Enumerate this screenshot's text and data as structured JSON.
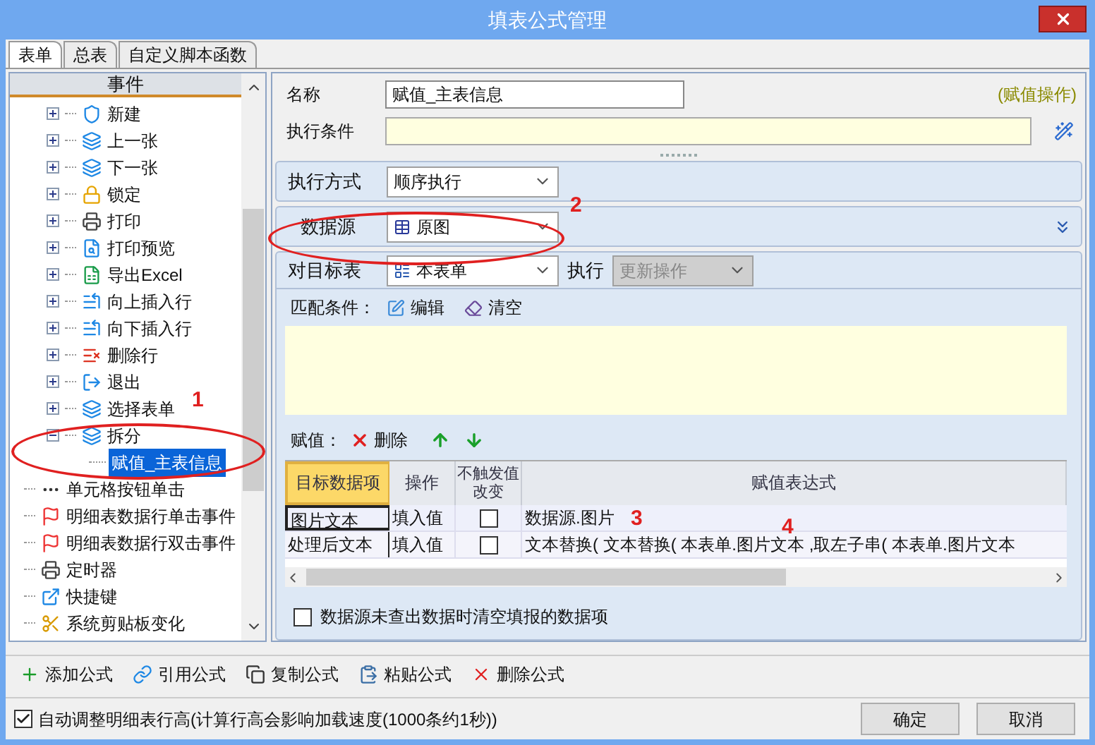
{
  "window": {
    "title": "填表公式管理"
  },
  "tabs": [
    {
      "label": "表单",
      "selected": true
    },
    {
      "label": "总表",
      "selected": false
    },
    {
      "label": "自定义脚本函数",
      "selected": false
    }
  ],
  "sidebar": {
    "header": "事件",
    "items": [
      {
        "label": "新建",
        "kind": "group",
        "expanded": false
      },
      {
        "label": "上一张",
        "kind": "group",
        "expanded": false
      },
      {
        "label": "下一张",
        "kind": "group",
        "expanded": false
      },
      {
        "label": "锁定",
        "kind": "group",
        "expanded": false
      },
      {
        "label": "打印",
        "kind": "group",
        "expanded": false
      },
      {
        "label": "打印预览",
        "kind": "group",
        "expanded": false
      },
      {
        "label": "导出Excel",
        "kind": "group",
        "expanded": false
      },
      {
        "label": "向上插入行",
        "kind": "group",
        "expanded": false
      },
      {
        "label": "向下插入行",
        "kind": "group",
        "expanded": false
      },
      {
        "label": "删除行",
        "kind": "group",
        "expanded": false
      },
      {
        "label": "退出",
        "kind": "group",
        "expanded": false
      },
      {
        "label": "选择表单",
        "kind": "group",
        "expanded": false
      },
      {
        "label": "拆分",
        "kind": "group",
        "expanded": true,
        "children": [
          {
            "label": "赋值_主表信息",
            "selected": true
          }
        ]
      },
      {
        "label": "单元格按钮单击",
        "kind": "leaf"
      },
      {
        "label": "明细表数据行单击事件",
        "kind": "leaf"
      },
      {
        "label": "明细表数据行双击事件",
        "kind": "leaf"
      },
      {
        "label": "定时器",
        "kind": "leaf"
      },
      {
        "label": "快捷键",
        "kind": "leaf"
      },
      {
        "label": "系统剪贴板变化",
        "kind": "leaf"
      }
    ]
  },
  "form": {
    "name_label": "名称",
    "name_value": "赋值_主表信息",
    "type_badge": "(赋值操作)",
    "condition_label": "执行条件",
    "exec_mode_label": "执行方式",
    "exec_mode_value": "顺序执行",
    "datasource_label": "数据源",
    "datasource_value": "原图",
    "target_label": "对目标表",
    "target_value": "本表单",
    "exec_label": "执行",
    "exec_value": "更新操作",
    "match_label": "匹配条件：",
    "match_edit": "编辑",
    "match_clear": "清空",
    "assign_label": "赋值：",
    "assign_delete": "删除",
    "table": {
      "columns": [
        "目标数据项",
        "操作",
        "不触发值改变",
        "赋值表达式"
      ],
      "rows": [
        {
          "target": "图片文本",
          "op": "填入值",
          "checked": false,
          "expr": "数据源.图片",
          "selected": true
        },
        {
          "target": "处理后文本",
          "op": "填入值",
          "checked": false,
          "expr": "文本替换( 文本替换(  本表单.图片文本  ,取左子串(    本表单.图片文本",
          "selected": false
        }
      ]
    },
    "clear_option": {
      "label": "数据源未查出数据时清空填报的数据项",
      "checked": false
    }
  },
  "toolbar": [
    "添加公式",
    "引用公式",
    "复制公式",
    "粘贴公式",
    "删除公式"
  ],
  "footer": {
    "auto_height": {
      "label": "自动调整明细表行高(计算行高会影响加载速度(1000条约1秒))",
      "checked": true
    },
    "buttons": [
      "确定",
      "取消"
    ]
  },
  "annotations": [
    "1",
    "2",
    "3",
    "4"
  ]
}
